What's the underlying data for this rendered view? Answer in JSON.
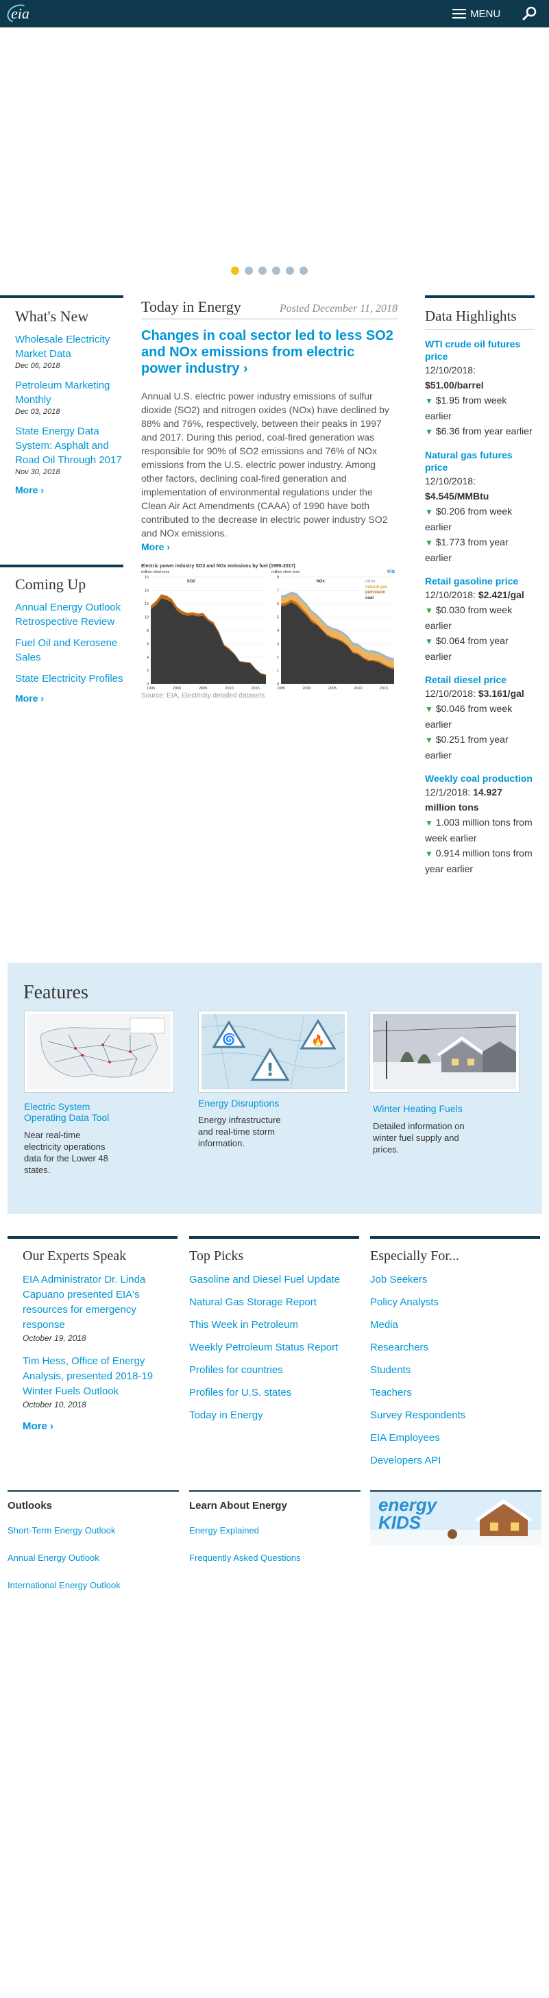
{
  "header": {
    "logo": "eia",
    "menu_label": "MENU"
  },
  "whats_new": {
    "title": "What's New",
    "items": [
      {
        "label": "Wholesale Electricity Market Data",
        "date": "Dec 06, 2018"
      },
      {
        "label": "Petroleum Marketing Monthly",
        "date": "Dec 03, 2018"
      },
      {
        "label": "State Energy Data System: Asphalt and Road Oil Through 2017",
        "date": "Nov 30, 2018"
      }
    ],
    "more": "More ›"
  },
  "coming_up": {
    "title": "Coming Up",
    "items": [
      "Annual Energy Outlook Retrospective Review",
      "Fuel Oil and Kerosene Sales",
      "State Electricity Profiles"
    ],
    "more": "More ›"
  },
  "today_in_energy": {
    "title": "Today in Energy",
    "posted": "Posted December 11, 2018",
    "headline": "Changes in coal sector led to less SO2 and NOx emissions from electric power industry ›",
    "body": "Annual U.S. electric power industry emissions of sulfur dioxide (SO2) and nitrogen oxides (NOx) have declined by 88% and 76%, respectively, between their peaks in 1997 and 2017. During this period, coal-fired generation was responsible for 90% of SO2 emissions and 76% of NOx emissions from the U.S. electric power industry. Among other factors, declining coal-fired generation and implementation of environmental regulations under the Clean Air Act Amendments (CAAA) of 1990 have both contributed to the decrease in electric power industry SO2 and NOx emissions.",
    "more": "More ›",
    "source": "Source: EIA, Electricity detailed datasets"
  },
  "chart_data": [
    {
      "type": "area",
      "title": "Electric power industry SO2 and NOx emissions by fuel (1995-2017)",
      "panel": "SO2",
      "ylabel": "million short tons",
      "ylim": [
        0,
        16
      ],
      "yticks": [
        "0",
        "2",
        "4",
        "6",
        "8",
        "10",
        "12",
        "14",
        "16"
      ],
      "xticks": [
        "1995",
        "2000",
        "2005",
        "2010",
        "2015"
      ],
      "x": [
        1995,
        1996,
        1997,
        1998,
        1999,
        2000,
        2001,
        2002,
        2003,
        2004,
        2005,
        2006,
        2007,
        2008,
        2009,
        2010,
        2011,
        2012,
        2013,
        2014,
        2015,
        2016,
        2017
      ],
      "series": [
        {
          "name": "coal",
          "values": [
            11.2,
            11.8,
            12.8,
            12.6,
            12.2,
            11.0,
            10.4,
            10.2,
            10.3,
            10.1,
            10.2,
            9.4,
            8.9,
            7.6,
            5.7,
            5.1,
            4.4,
            3.3,
            3.2,
            3.1,
            2.2,
            1.5,
            1.3
          ]
        },
        {
          "name": "petroleum",
          "values": [
            0.5,
            0.6,
            0.6,
            0.6,
            0.5,
            0.5,
            0.5,
            0.4,
            0.4,
            0.4,
            0.4,
            0.3,
            0.3,
            0.2,
            0.2,
            0.2,
            0.1,
            0.1,
            0.1,
            0.1,
            0.1,
            0.1,
            0.1
          ]
        }
      ]
    },
    {
      "type": "area",
      "panel": "NOx",
      "ylabel": "million short tons",
      "ylim": [
        0,
        8
      ],
      "yticks": [
        "0",
        "1",
        "2",
        "3",
        "4",
        "5",
        "6",
        "7",
        "8"
      ],
      "xticks": [
        "1995",
        "2000",
        "2005",
        "2010",
        "2015"
      ],
      "x": [
        1995,
        1996,
        1997,
        1998,
        1999,
        2000,
        2001,
        2002,
        2003,
        2004,
        2005,
        2006,
        2007,
        2008,
        2009,
        2010,
        2011,
        2012,
        2013,
        2014,
        2015,
        2016,
        2017
      ],
      "series": [
        {
          "name": "coal",
          "values": [
            5.8,
            5.9,
            6.1,
            5.9,
            5.5,
            5.1,
            4.6,
            4.4,
            4.0,
            3.6,
            3.4,
            3.3,
            3.1,
            2.8,
            2.3,
            2.2,
            1.9,
            1.7,
            1.7,
            1.6,
            1.4,
            1.2,
            1.1
          ]
        },
        {
          "name": "petroleum",
          "values": [
            0.2,
            0.2,
            0.2,
            0.2,
            0.2,
            0.2,
            0.2,
            0.1,
            0.1,
            0.1,
            0.1,
            0.1,
            0.1,
            0.1,
            0.1,
            0.1,
            0.1,
            0.1,
            0.1,
            0.1,
            0.1,
            0.1,
            0.1
          ]
        },
        {
          "name": "natural gas",
          "values": [
            0.4,
            0.4,
            0.4,
            0.5,
            0.5,
            0.5,
            0.5,
            0.5,
            0.5,
            0.5,
            0.5,
            0.5,
            0.5,
            0.5,
            0.5,
            0.5,
            0.5,
            0.5,
            0.5,
            0.5,
            0.5,
            0.5,
            0.5
          ]
        },
        {
          "name": "other",
          "values": [
            0.2,
            0.2,
            0.2,
            0.2,
            0.2,
            0.2,
            0.2,
            0.2,
            0.2,
            0.2,
            0.2,
            0.2,
            0.2,
            0.2,
            0.2,
            0.2,
            0.2,
            0.2,
            0.2,
            0.2,
            0.2,
            0.2,
            0.2
          ]
        }
      ]
    }
  ],
  "data_highlights": {
    "title": "Data Highlights",
    "items": [
      {
        "title": "WTI crude oil futures price",
        "date": "12/10/2018:",
        "value": "$51.00/barrel",
        "c1": "$1.95 from week earlier",
        "c2": "$6.36 from year earlier"
      },
      {
        "title": "Natural gas futures price",
        "date": "12/10/2018:",
        "value": "$4.545/MMBtu",
        "c1": "$0.206 from week earlier",
        "c2": "$1.773 from year earlier"
      },
      {
        "title": "Retail gasoline price",
        "date": "12/10/2018:",
        "value": "$2.421/gal",
        "c1": "$0.030 from week earlier",
        "c2": "$0.064 from year earlier"
      },
      {
        "title": "Retail diesel price",
        "date": "12/10/2018:",
        "value": "$3.161/gal",
        "c1": "$0.046 from week earlier",
        "c2": "$0.251 from year earlier"
      },
      {
        "title": "Weekly coal production",
        "date": "12/1/2018:",
        "value": "14.927 million tons",
        "c1": "1.003 million tons from week earlier",
        "c2": "0.914 million tons from year earlier"
      }
    ]
  },
  "features": {
    "title": "Features",
    "items": [
      {
        "label": "Electric System Operating Data Tool",
        "desc": "Near real-time electricity operations data for the Lower 48 states."
      },
      {
        "label": "Energy Disruptions",
        "desc": "Energy infrastructure and real-time storm information."
      },
      {
        "label": "Winter Heating Fuels",
        "desc": "Detailed information on winter fuel supply and prices."
      }
    ]
  },
  "experts": {
    "title": "Our Experts Speak",
    "items": [
      {
        "label": "EIA Administrator Dr. Linda Capuano presented EIA's resources for emergency response",
        "date": "October 19, 2018"
      },
      {
        "label": "Tim Hess, Office of Energy Analysis, presented 2018-19 Winter Fuels Outlook",
        "date": "October 10, 2018"
      }
    ],
    "more": "More ›"
  },
  "top_picks": {
    "title": "Top Picks",
    "items": [
      "Gasoline and Diesel Fuel Update",
      "Natural Gas Storage Report",
      "This Week in Petroleum",
      "Weekly Petroleum Status Report",
      "Profiles for countries",
      "Profiles for U.S. states",
      "Today in Energy"
    ]
  },
  "especially_for": {
    "title": "Especially For...",
    "items": [
      "Job Seekers",
      "Policy Analysts",
      "Media",
      "Researchers",
      "Students",
      "Teachers",
      "Survey Respondents",
      "EIA Employees",
      "Developers API"
    ]
  },
  "outlooks": {
    "title": "Outlooks",
    "items": [
      "Short-Term Energy Outlook",
      "Annual Energy Outlook",
      "International Energy Outlook"
    ]
  },
  "learn": {
    "title": "Learn About Energy",
    "items": [
      "Energy Explained",
      "Frequently Asked Questions"
    ]
  },
  "energy_kids": {
    "logo": "energy KIDS"
  },
  "colors": {
    "navy": "#0f3a4e",
    "link": "#0096d6",
    "features_bg": "#dcecf6",
    "carousel_active": "#f3c313"
  }
}
